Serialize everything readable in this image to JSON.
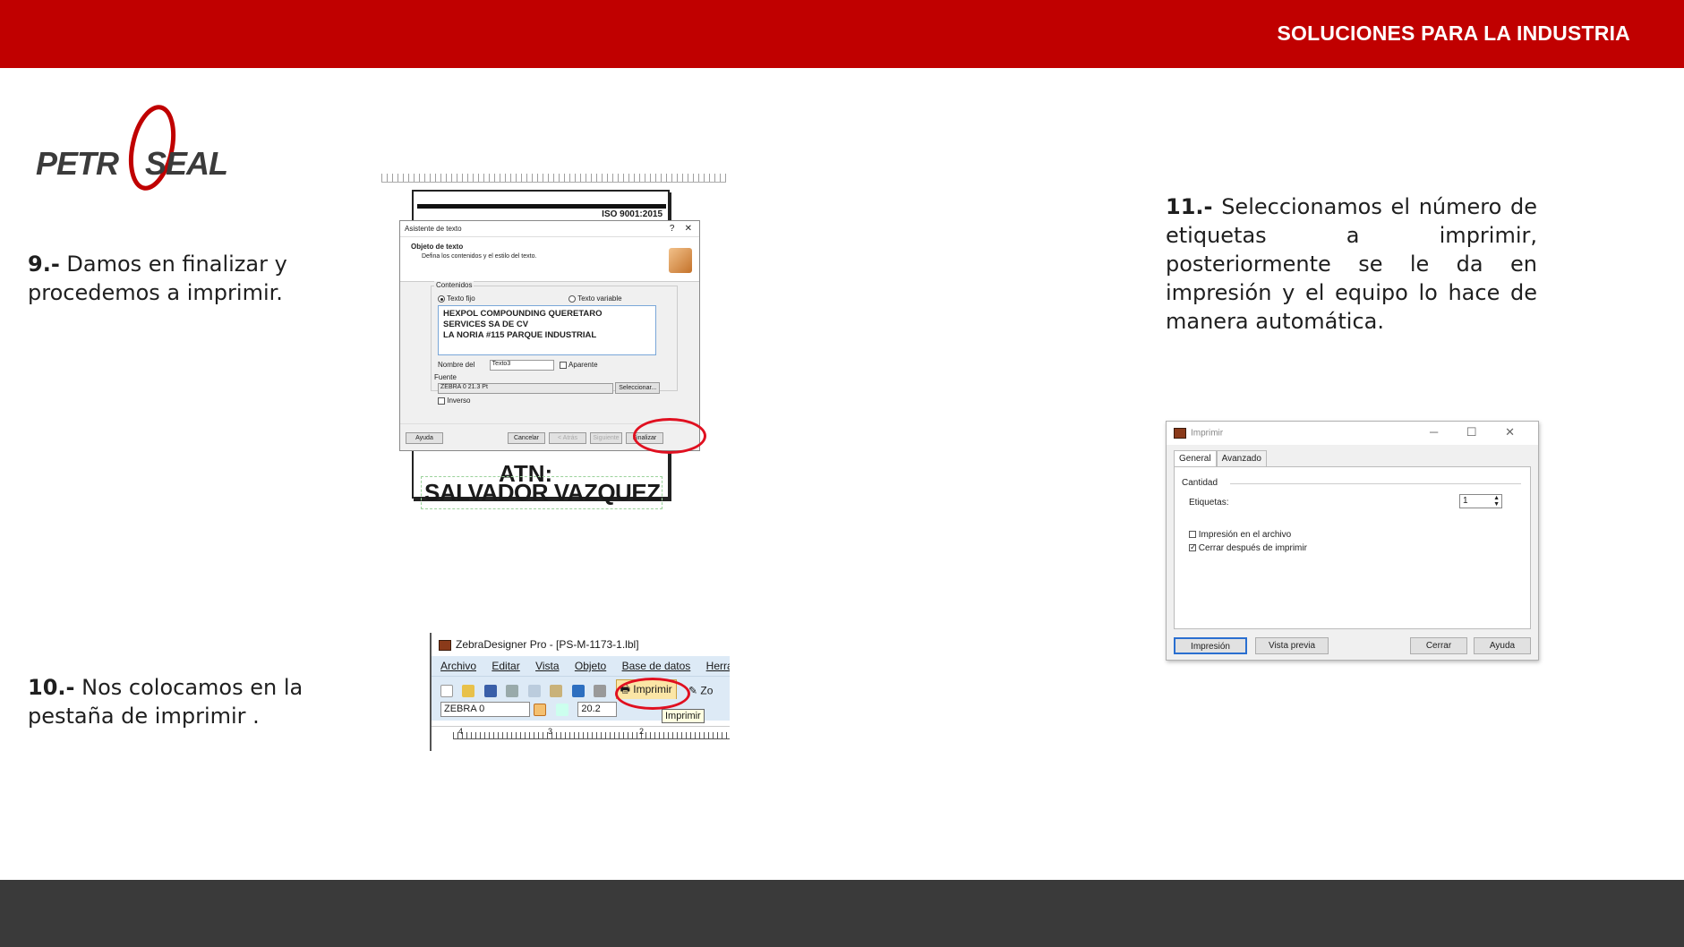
{
  "header": {
    "tagline": "SOLUCIONES PARA LA INDUSTRIA"
  },
  "logo": {
    "text_left": "PETR",
    "text_right": "SEAL"
  },
  "steps": {
    "s9": {
      "num": "9.-",
      "text": "Damos en finalizar y procedemos a imprimir."
    },
    "s10": {
      "num": "10.-",
      "text": "Nos colocamos en la pestaña de imprimir ."
    },
    "s11": {
      "num": "11.-",
      "text": "Seleccionamos el número de etiquetas a imprimir, posteriormente se le da en impresión y el equipo lo hace de manera automática."
    }
  },
  "shot1": {
    "label_iso": "ISO 9001:2015",
    "label_atn": "ATN:",
    "label_name": "SALVADOR VAZQUEZ",
    "dialog": {
      "title": "Asistente de texto",
      "title_help": "?",
      "title_close": "✕",
      "heading": "Objeto de texto",
      "subheading": "Defina los contenidos y el estilo del texto.",
      "contents_label": "Contenidos",
      "radio_fixed": "Texto fijo",
      "radio_variable": "Texto variable",
      "text_lines": [
        "HEXPOL COMPOUNDING QUERETARO",
        "SERVICES SA DE CV",
        "LA NORIA #115 PARQUE INDUSTRIAL"
      ],
      "name_label": "Nombre del",
      "name_value": "Texto3",
      "visible_label": "Aparente",
      "font_label": "Fuente",
      "font_value": "ZEBRA 0 21.3 Pt",
      "select_button": "Seleccionar...",
      "inverse_label": "Inverso",
      "buttons": {
        "help": "Ayuda",
        "cancel": "Cancelar",
        "back": "< Atrás",
        "next": "Siguiente",
        "finish": "Finalizar"
      }
    }
  },
  "shot2": {
    "window_title": "ZebraDesigner Pro - [PS-M-1173-1.lbl]",
    "menu": [
      "Archivo",
      "Editar",
      "Vista",
      "Objeto",
      "Base de datos",
      "Herrami"
    ],
    "print_button": "Imprimir",
    "zoom_partial": "Zo",
    "font_combo": "ZEBRA 0",
    "size_combo": "20.2",
    "tooltip": "Imprimir",
    "ruler_marks": [
      "4",
      "3",
      "2"
    ]
  },
  "shot3": {
    "title": "Imprimir",
    "window_buttons": "─ ☐ ✕",
    "tabs": [
      "General",
      "Avanzado"
    ],
    "quantity_label": "Cantidad",
    "labels_label": "Etiquetas:",
    "labels_value": "1",
    "option_file": "Impresión en el archivo",
    "option_close": "Cerrar después de imprimir",
    "buttons": {
      "print": "Impresión",
      "preview": "Vista previa",
      "close": "Cerrar",
      "help": "Ayuda"
    }
  },
  "colors": {
    "brand_red": "#c00000",
    "footer_gray": "#3a3a3a",
    "highlight_oval": "#e01020"
  }
}
